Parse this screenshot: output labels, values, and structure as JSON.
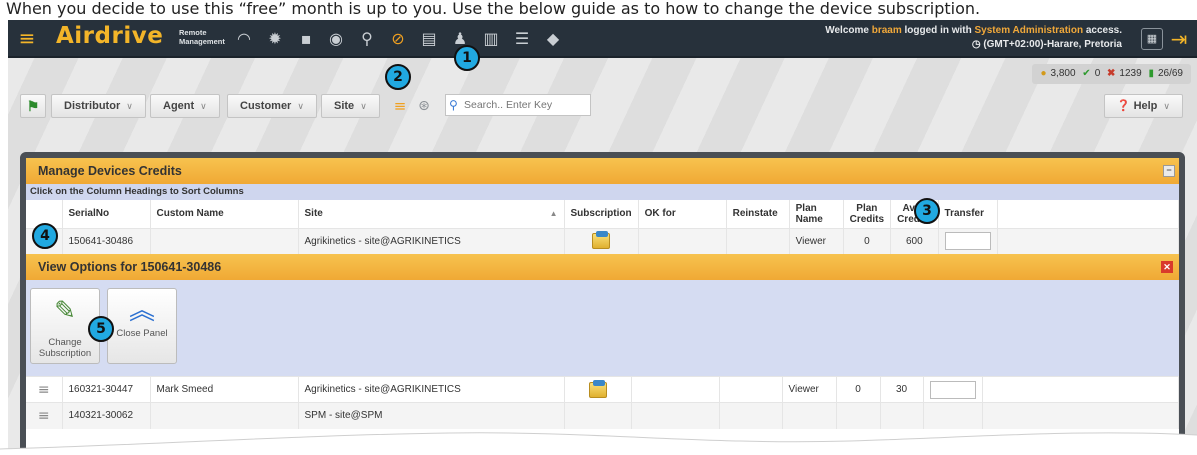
{
  "caption": "When you decide to use this “free” month is up to you. Use the below guide as to how to change the device subscription.",
  "topbar": {
    "brand": "Airdrive",
    "brand_sub": "Remote Management",
    "welcome_prefix": "Welcome ",
    "user": "braam",
    "welcome_mid": " logged in with ",
    "role": "System Administration",
    "welcome_suffix": " access.",
    "timezone": "(GMT+02:00)-Harare, Pretoria",
    "icons": [
      "dashboard-icon",
      "settings-icon",
      "apps-icon",
      "eye-icon",
      "hierarchy-icon",
      "subscription-icon",
      "document-icon",
      "users-icon",
      "book-icon",
      "list-icon",
      "bell-icon"
    ]
  },
  "stats": {
    "credits": "3,800",
    "ok": "0",
    "errors": "1239",
    "devices": "26/69"
  },
  "filters": {
    "distributor": "Distributor",
    "agent": "Agent",
    "customer": "Customer",
    "site": "Site",
    "search_placeholder": "Search.. Enter Key",
    "help": "Help"
  },
  "panel": {
    "title": "Manage Devices Credits",
    "sort_hint": "Click on the Column Headings to Sort Columns",
    "columns": {
      "serial": "SerialNo",
      "custom_name": "Custom Name",
      "site": "Site",
      "subscription": "Subscription",
      "ok_for": "OK for",
      "reinstate": "Reinstate",
      "plan_name": "Plan Name",
      "plan_credits": "Plan Credits",
      "avail_credits": "Avail Credits",
      "transfer": "Transfer"
    },
    "rows": [
      {
        "serial": "150641-30486",
        "custom_name": "",
        "site": "Agrikinetics - site@AGRIKINETICS",
        "plan_name": "Viewer",
        "plan_credits": "0",
        "avail_credits": "600"
      },
      {
        "serial": "160321-30447",
        "custom_name": "Mark Smeed",
        "site": "Agrikinetics - site@AGRIKINETICS",
        "plan_name": "Viewer",
        "plan_credits": "0",
        "avail_credits": "30"
      },
      {
        "serial": "140321-30062",
        "custom_name": "",
        "site": "SPM - site@SPM",
        "plan_name": "",
        "plan_credits": "",
        "avail_credits": ""
      }
    ],
    "options_title": "View Options for 150641-30486",
    "change_subscription": "Change Subscription",
    "close_panel": "Close Panel"
  },
  "callouts": [
    "1",
    "2",
    "3",
    "4",
    "5"
  ]
}
